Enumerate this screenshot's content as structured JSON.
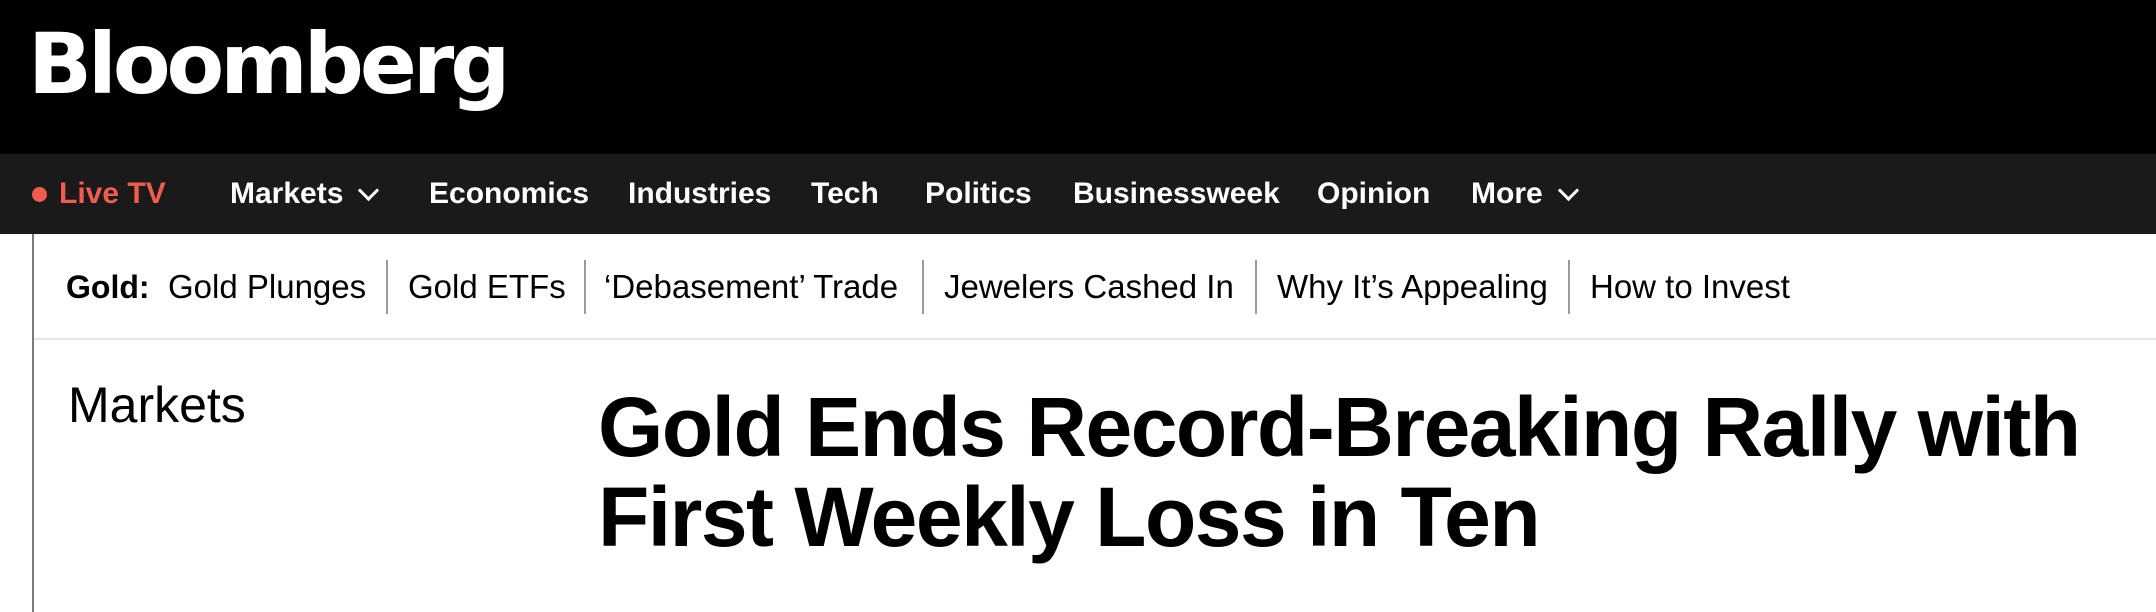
{
  "brand": {
    "logo_text": "Bloomberg",
    "background_color": "#000000"
  },
  "nav": {
    "background_color": "#1a1a1a",
    "live": {
      "label": "Live TV",
      "color": "#f25c4e",
      "icon": "live-dot-icon"
    },
    "items": [
      {
        "label": "Markets",
        "has_dropdown": true
      },
      {
        "label": "Economics"
      },
      {
        "label": "Industries"
      },
      {
        "label": "Tech"
      },
      {
        "label": "Politics"
      },
      {
        "label": "Businessweek"
      },
      {
        "label": "Opinion"
      },
      {
        "label": "More",
        "has_dropdown": true
      }
    ]
  },
  "topic_strip": {
    "label": "Gold:",
    "links": [
      "Gold Plunges",
      "Gold ETFs",
      "‘Debasement’ Trade",
      "Jewelers Cashed In",
      "Why It’s Appealing",
      "How to Invest"
    ]
  },
  "article": {
    "section": "Markets",
    "headline_lines": [
      "Gold Ends Record-Breaking Rally with",
      "First Weekly Loss in Ten"
    ]
  }
}
